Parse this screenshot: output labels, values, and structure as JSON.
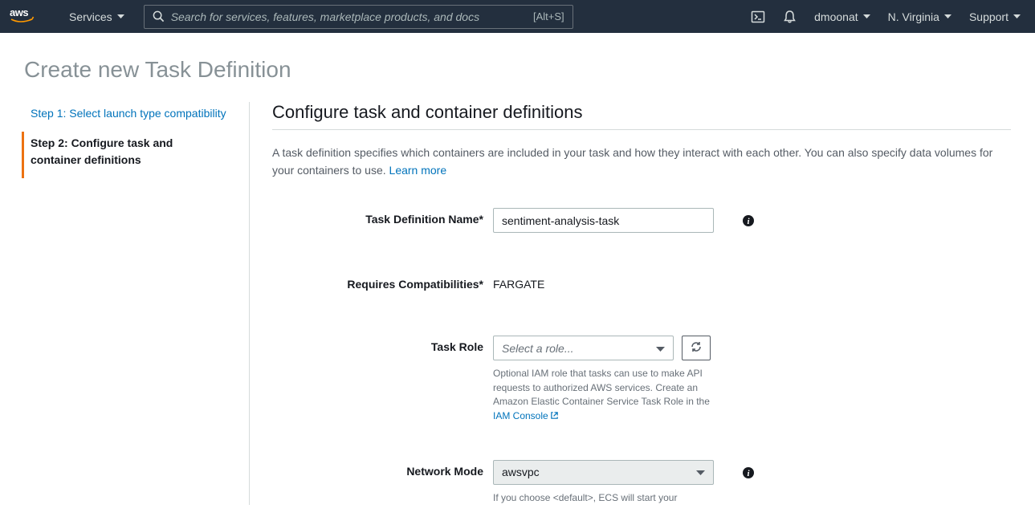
{
  "nav": {
    "services": "Services",
    "search_placeholder": "Search for services, features, marketplace products, and docs",
    "search_shortcut": "[Alt+S]",
    "user": "dmoonat",
    "region": "N. Virginia",
    "support": "Support"
  },
  "page": {
    "title": "Create new Task Definition"
  },
  "steps": {
    "step1": "Step 1: Select launch type compatibility",
    "step2": "Step 2: Configure task and container definitions"
  },
  "section": {
    "title": "Configure task and container definitions",
    "desc_a": "A task definition specifies which containers are included in your task and how they interact with each other. You can also specify data volumes for your containers to use. ",
    "learn_more": "Learn more"
  },
  "form": {
    "name_label": "Task Definition Name*",
    "name_value": "sentiment-analysis-task",
    "compat_label": "Requires Compatibilities*",
    "compat_value": "FARGATE",
    "role_label": "Task Role",
    "role_placeholder": "Select a role...",
    "role_help_a": "Optional IAM role that tasks can use to make API requests to authorized AWS services. Create an Amazon Elastic Container Service Task Role in the ",
    "role_help_link": "IAM Console",
    "network_label": "Network Mode",
    "network_value": "awsvpc",
    "network_help": "If you choose <default>, ECS will start your"
  }
}
